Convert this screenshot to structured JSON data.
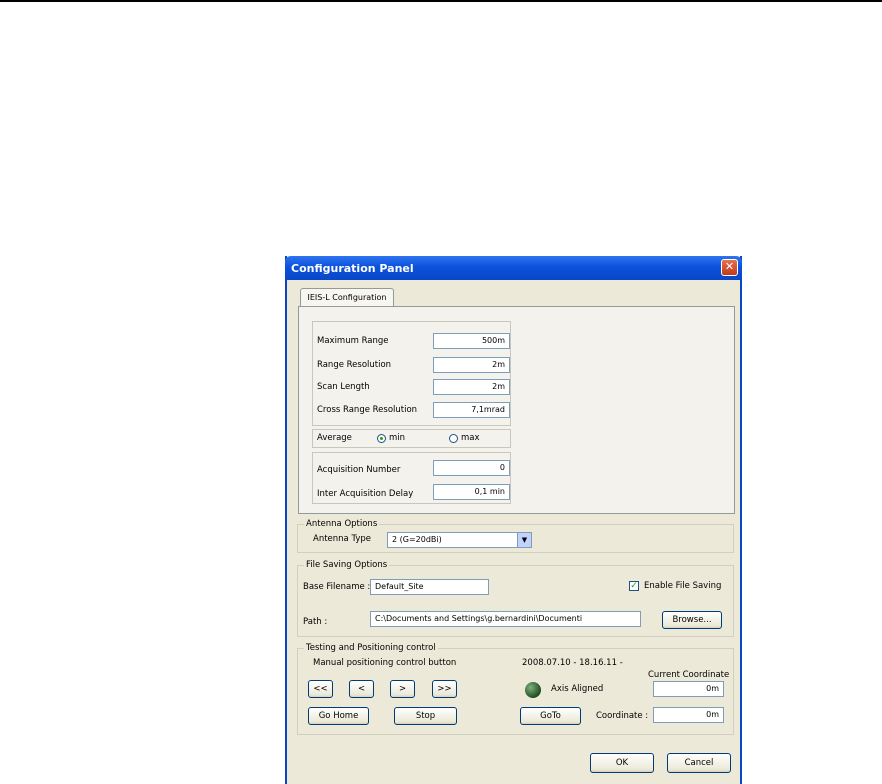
{
  "dialog": {
    "title": "Configuration Panel",
    "close_glyph": "✕",
    "tab_label": "IEIS-L Configuration",
    "config": {
      "max_range_label": "Maximum Range",
      "max_range_value": "500m",
      "range_res_label": "Range Resolution",
      "range_res_value": "2m",
      "scan_length_label": "Scan Length",
      "scan_length_value": "2m",
      "cross_res_label": "Cross Range Resolution",
      "cross_res_value": "7,1mrad",
      "average_label": "Average",
      "average_min": "min",
      "average_max": "max",
      "average_selected": "min",
      "acq_number_label": "Acquisition Number",
      "acq_number_value": "0",
      "inter_delay_label": "Inter Acquisition Delay",
      "inter_delay_value": "0,1 min"
    },
    "antenna": {
      "group_label": "Antenna Options",
      "type_label": "Antenna Type",
      "type_value": "2 (G=20dBi)",
      "dropdown_icon": "chevron-down-icon",
      "dropdown_glyph": "▼"
    },
    "file_saving": {
      "group_label": "File Saving Options",
      "base_label": "Base Filename :",
      "base_value": "Default_Site",
      "enable_label": "Enable File Saving",
      "enable_checked": true,
      "check_glyph": "✓",
      "path_label": "Path :",
      "path_value": "C:\\Documents and Settings\\g.bernardini\\Documenti",
      "browse_label": "Browse..."
    },
    "testing": {
      "group_label": "Testing and Positioning control",
      "manual_label": "Manual positioning control button",
      "fast_back": "<<",
      "back": "<",
      "forward": ">",
      "fast_forward": ">>",
      "go_home": "Go Home",
      "stop": "Stop",
      "timestamp": "2008.07.10 - 18.16.11 -",
      "axis_status": "Axis Aligned",
      "axis_led_color": "#2a5a2a",
      "current_coord_label": "Current Coordinate",
      "current_coord_value": "0m",
      "goto_label": "GoTo",
      "coord_label": "Coordinate :",
      "coord_value": "0m"
    },
    "ok_label": "OK",
    "cancel_label": "Cancel"
  }
}
